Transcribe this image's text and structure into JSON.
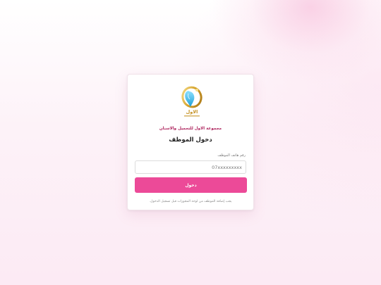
{
  "organization": {
    "name": "مجموعة الاول للتجميل والاسنان",
    "logo_icon": "ring-with-blue-tooth-logo",
    "logo_text": "الاول",
    "brand_color": "#ec4a98",
    "accent_text_color": "#b02a62"
  },
  "login": {
    "title": "دخول الموظف",
    "phone_label": "رقم هاتف الموظف",
    "phone_placeholder": "07xxxxxxxxx",
    "phone_value": "",
    "submit_label": "دخول",
    "hint": "يجب إضافة الموظف من لوحة المجوزات قبل تسجيل الدخول."
  }
}
